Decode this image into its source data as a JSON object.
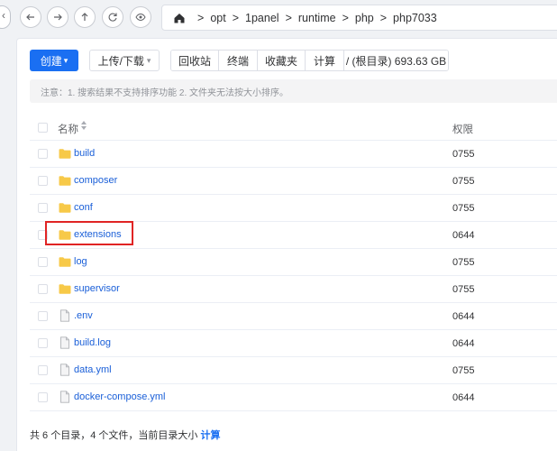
{
  "path": [
    "opt",
    "1panel",
    "runtime",
    "php",
    "php7033"
  ],
  "path_separator": ">",
  "toolbar": {
    "create_label": "创建",
    "upload_label": "上传/下载",
    "recycle_label": "回收站",
    "terminal_label": "终端",
    "favorites_label": "收藏夹",
    "calc_label": "计算",
    "disk_label": "/ (根目录) 693.63 GB"
  },
  "notice": "注意：1. 搜索结果不支持排序功能 2. 文件夹无法按大小排序。",
  "table": {
    "col_name": "名称",
    "col_perm": "权限",
    "rows": [
      {
        "name": "build",
        "type": "folder",
        "perm": "0755"
      },
      {
        "name": "composer",
        "type": "folder",
        "perm": "0755"
      },
      {
        "name": "conf",
        "type": "folder",
        "perm": "0755"
      },
      {
        "name": "extensions",
        "type": "folder",
        "perm": "0644"
      },
      {
        "name": "log",
        "type": "folder",
        "perm": "0755"
      },
      {
        "name": "supervisor",
        "type": "folder",
        "perm": "0755"
      },
      {
        "name": ".env",
        "type": "file",
        "perm": "0644"
      },
      {
        "name": "build.log",
        "type": "file",
        "perm": "0644"
      },
      {
        "name": "data.yml",
        "type": "file",
        "perm": "0755"
      },
      {
        "name": "docker-compose.yml",
        "type": "file",
        "perm": "0644"
      }
    ]
  },
  "footer": {
    "summary": "共 6 个目录，4 个文件，当前目录大小",
    "calc_link": "计算"
  },
  "colors": {
    "primary": "#1a6ff2",
    "folder": "#f7c948",
    "highlight": "#e02424",
    "link": "#1a5fd8"
  }
}
